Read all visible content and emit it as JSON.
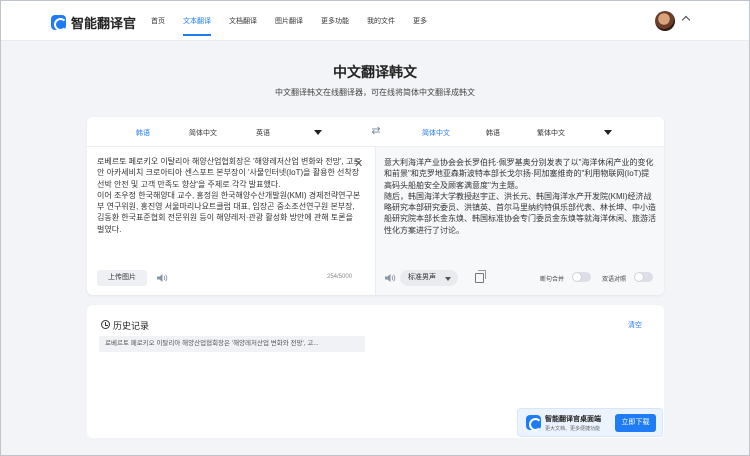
{
  "header": {
    "logo_text": "智能翻译官",
    "nav": [
      "首页",
      "文本翻译",
      "文档翻译",
      "图片翻译",
      "更多功能",
      "我的文件",
      "更多"
    ],
    "active_nav": "文本翻译"
  },
  "page": {
    "title": "中文翻译韩文",
    "subtitle": "中文翻译韩文在线翻译器，可在线将简体中文翻译成韩文"
  },
  "translator": {
    "source_langs": {
      "detect": "韩语",
      "chinese": "简体中文",
      "english": "英语"
    },
    "target_langs": {
      "chinese": "简体中文",
      "korean": "韩语",
      "traditional": "繁体中文"
    },
    "source_text": "로베르토 페로키오 이탈리아 해양산업협회장은 '해양레저산업 변화와 전망', 고르안 아카세비치 크로아티아 센스포트 본부장이 '사물인터넷(IoT)을 활용한 선착장 선박 안전 및 고객 만족도 향상'을 주제로 각각 발표했다.\n이어 조우정 한국해양대 교수, 홍정원 한국해양수산개발원(KMI) 경제전략연구본부 연구위원, 홍진영 서울마리나요트클럽 대표, 임장곤 중소조선연구원 본부장, 김동환 한국표준협회 전문위원 등이 해양레저·관광 활성화 방안에 관해 토론을 벌였다.",
    "upload_label": "上传图片",
    "char_count": "254/5000",
    "target_text": "意大利海洋产业协会会长罗伯托·佩罗基奥分别发表了以\"海洋休闲产业的变化和前景\"和克罗地亚森斯波特本部长戈尔扬·阿加塞维奇的\"利用物联网(IoT)提高码头船舶安全及顾客满意度\"为主题。\n随后，韩国海洋大学教授赵宇正、洪长元、韩国海洋水产开发院(KMI)经济战略研究本部研究委员、洪镇英、首尔马里纳约特俱乐部代表、林长坤、中小造船研究院本部长金东焕、韩国标准协会专门委员金东焕等就海洋休闲、旅游活性化方案进行了讨论。",
    "voice_label": "标准男声",
    "toggle_sentence": "断句合并",
    "toggle_bilingual": "双语对照"
  },
  "history": {
    "title": "历史记录",
    "clear_label": "清空",
    "items": [
      "로베르토 페로키오 이탈리아 해양산업협회장은 '해양레저산업 변화와 전망', 고..."
    ]
  },
  "banner": {
    "title": "智能翻译官桌面端",
    "subtitle": "更大文档、更多便捷功能",
    "button": "立即下载"
  },
  "colors": {
    "accent": "#1f7cf5",
    "background": "#f2f4f7"
  }
}
